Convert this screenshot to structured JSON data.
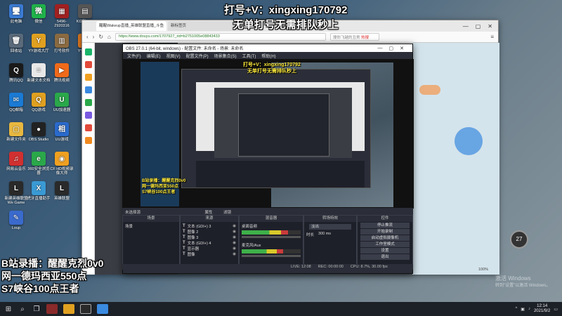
{
  "desktop": {
    "icons": [
      {
        "label": "此电脑",
        "glyph": "🖥",
        "color": "#3b7bd4"
      },
      {
        "label": "微信",
        "glyph": "微",
        "color": "#20b34a"
      },
      {
        "label": "5496-2920316",
        "glyph": "▦",
        "color": "#a02020"
      },
      {
        "label": "KG刷\n—X",
        "glyph": "▤",
        "color": "#555"
      },
      {
        "label": "回收站",
        "glyph": "🗑",
        "color": "#5a6a7a"
      },
      {
        "label": "YY游戏大厅",
        "glyph": "Y",
        "color": "#e0a020"
      },
      {
        "label": "打号软件",
        "glyph": "▥",
        "color": "#8a6a40"
      },
      {
        "label": "YY播\n80",
        "glyph": "Y",
        "color": "#e07a20"
      },
      {
        "label": "腾讯QQ",
        "glyph": "Q",
        "color": "#1a1a1a"
      },
      {
        "label": "新建文本文档",
        "glyph": "≡",
        "color": "#e8e8e8"
      },
      {
        "label": "腾讯视频",
        "glyph": "▶",
        "color": "#f06a1a"
      },
      {
        "label": "WeGame",
        "glyph": "W",
        "color": "#d04030"
      },
      {
        "label": "QQ邮箱",
        "glyph": "✉",
        "color": "#1a7ad4"
      },
      {
        "label": "QQ游戏",
        "glyph": "Q",
        "color": "#e0a020"
      },
      {
        "label": "UU加速器",
        "glyph": "U",
        "color": "#2aa84a"
      },
      {
        "label": "电脑管家",
        "glyph": "◆",
        "color": "#1a7ad4"
      },
      {
        "label": "新建文件夹",
        "glyph": "▢",
        "color": "#e8b840"
      },
      {
        "label": "OBS Studio",
        "glyph": "●",
        "color": "#222"
      },
      {
        "label": "UU游戏",
        "glyph": "相",
        "color": "#2a6acc"
      },
      {
        "label": "迅游网游加速",
        "glyph": "⚡",
        "color": "#e04020"
      },
      {
        "label": "网易云音乐",
        "glyph": "♫",
        "color": "#d03030"
      },
      {
        "label": "360安全浏览器",
        "glyph": "e",
        "color": "#2aa84a"
      },
      {
        "label": "CF HD视频录像大师",
        "glyph": "◉",
        "color": "#f0a020"
      },
      {
        "label": "英雄联盟",
        "glyph": "L",
        "color": "#2a2a2a"
      },
      {
        "label": "新建英雄联盟We Game",
        "glyph": "L",
        "color": "#2a2a2a"
      },
      {
        "label": "虎牙直播助手",
        "glyph": "X",
        "color": "#3a9ad4"
      },
      {
        "label": "英雄联盟",
        "glyph": "L",
        "color": "#2a2a2a"
      },
      {
        "label": "新建英雄联盟",
        "glyph": "L",
        "color": "#2a2a2a"
      },
      {
        "label": "Loup",
        "glyph": "✎",
        "color": "#3a6acc"
      }
    ]
  },
  "browser": {
    "tabs": [
      {
        "label": "醒醒Wakeup直播_英雄联盟直播_斗鱼"
      },
      {
        "label": "新标签页"
      }
    ],
    "url": "https://www.douyu.com/1707927_rid=b2751005e08843433",
    "search_placeholder": "搜你飞越的丑男",
    "search_hot": "热搜",
    "zoom": "100%",
    "badge": "27"
  },
  "obs": {
    "title": "OBS 27.0.1 (64-bit, windows) - 配置文件: 未命名 - 场景: 未命名",
    "menu": [
      "文件(F)",
      "编辑(E)",
      "视图(V)",
      "配置文件(P)",
      "场景集合(S)",
      "工具(T)",
      "帮助(H)"
    ],
    "dock_head": "未选择源",
    "dock_head_right": "属性",
    "dock_head_filter": "滤镜",
    "docks": {
      "scenes": {
        "title": "场景",
        "items": [
          "场景"
        ]
      },
      "sources": {
        "title": "来源",
        "items": [
          "文本 (GDI+) 3",
          "图像 2",
          "图像 3",
          "文本 (GDI+) 4",
          "显示器",
          "图像"
        ]
      },
      "mixer": {
        "title": "混音器",
        "tracks": [
          "桌面音频",
          "麦克风/Aux"
        ]
      },
      "transitions": {
        "title": "转场特效",
        "fade": "淡出",
        "duration_label": "时长",
        "duration_value": "300 ms"
      },
      "controls": {
        "title": "控件",
        "buttons": [
          "停止推流",
          "开始录制",
          "启动虚拟摄像机",
          "工作室模式",
          "设置",
          "退出"
        ]
      }
    },
    "status": {
      "live": "LIVE: 12:08",
      "rec": "REC: 00:00:00",
      "cpu": "CPU: 8.7%, 30.00 fps"
    }
  },
  "overlays": {
    "top_line1": "打号+V：xingxing170792",
    "top_line2": "无单打号无需排队秒上",
    "left_lines": [
      "B站录播：醒醒克烈0v0",
      "网一德玛西亚550点",
      "S7峡谷100点王者"
    ],
    "mini_top_line1": "打号+V：xingxing170792",
    "mini_top_line2": "无单打号无需排队秒上",
    "mini_left_lines": [
      "B站录播：醒醒克烈0v0",
      "网一德玛西亚550点",
      "S7峡谷100点王者"
    ]
  },
  "watermark": {
    "line1": "激活 Windows",
    "line2": "转到\"设置\"以激活 Windows。"
  },
  "taskbar": {
    "time": "12:14",
    "date": "2021/9/2"
  }
}
